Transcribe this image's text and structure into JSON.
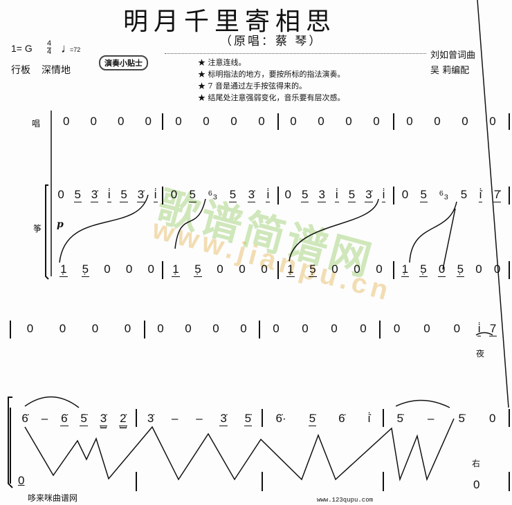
{
  "title": "明月千里寄相思",
  "subtitle": "（原唱：蔡  琴）",
  "key": "1= G",
  "time_top": "4",
  "time_bottom": "4",
  "tempo": "=72",
  "tempo_word": "行板",
  "expression": "深情地",
  "tips_label": "演奏小贴士",
  "tips": [
    "★ 注意连线。",
    "★ 标明指法的地方，要按所标的指法演奏。",
    "★ 7 音是通过左手按弦得来的。",
    "★ 结尾处注意强弱变化，音乐要有层次感。"
  ],
  "credits": [
    "刘如曾词曲",
    "吴  莉编配"
  ],
  "parts": {
    "voice": "唱",
    "zheng": "筝",
    "dynamic": "p"
  },
  "watermark": {
    "cn": "歌谱简谱网",
    "url": "www.jianpu.cn"
  },
  "system1": {
    "voice": [
      [
        "0",
        "0",
        "0",
        "0"
      ],
      [
        "0",
        "0",
        "0",
        "0"
      ],
      [
        "0",
        "0",
        "0",
        "0"
      ],
      [
        "0",
        "0",
        "0",
        "0"
      ]
    ],
    "upper": [
      [
        {
          "n": "0"
        },
        {
          "n": "5",
          "u": 1
        },
        {
          "n": "3̇",
          "u": 1
        },
        {
          "n": "i̇",
          "u": 1
        },
        {
          "n": "5",
          "u": 1
        },
        {
          "n": "3̇",
          "u": 1
        },
        {
          "n": "i̇",
          "u": 1
        }
      ],
      [
        {
          "n": "0"
        },
        {
          "n": "5",
          "u": 1
        },
        {
          "n": "⁶₃"
        },
        {
          "n": "5",
          "u": 1
        },
        {
          "n": "3̇",
          "u": 1
        },
        {
          "n": "i̇",
          "u": 1
        }
      ],
      [
        {
          "n": "0"
        },
        {
          "n": "5",
          "u": 1
        },
        {
          "n": "3",
          "u": 1
        },
        {
          "n": "i̇",
          "u": 1
        },
        {
          "n": "5",
          "u": 1
        },
        {
          "n": "3̇",
          "u": 1
        },
        {
          "n": "i̇",
          "u": 1
        }
      ],
      [
        {
          "n": "0"
        },
        {
          "n": "5",
          "u": 1
        },
        {
          "n": "⁶₃"
        },
        {
          "n": "5"
        },
        {
          "n": "i̇̇",
          "u": 1
        },
        {
          "n": "7̇",
          "u": 1
        }
      ]
    ],
    "lower": [
      [
        {
          "n": "1̣",
          "u": 1
        },
        {
          "n": "5̣",
          "u": 1
        },
        {
          "n": "0"
        },
        {
          "n": "0"
        },
        {
          "n": "0"
        }
      ],
      [
        {
          "n": "1̣",
          "u": 1
        },
        {
          "n": "5̣",
          "u": 1
        },
        {
          "n": "0"
        },
        {
          "n": "0"
        },
        {
          "n": "0"
        }
      ],
      [
        {
          "n": "1̣",
          "u": 1
        },
        {
          "n": "5̣",
          "u": 1
        },
        {
          "n": "0"
        },
        {
          "n": "0"
        },
        {
          "n": "0"
        }
      ],
      [
        {
          "n": "1̣",
          "u": 1
        },
        {
          "n": "5̣",
          "u": 1
        },
        {
          "n": "0",
          "u": 1
        },
        {
          "n": "5̣",
          "u": 1
        },
        {
          "n": "0"
        },
        {
          "n": "0"
        }
      ]
    ]
  },
  "system2": {
    "voice": [
      [
        "0",
        "0",
        "0",
        "0"
      ],
      [
        "0",
        "0",
        "0",
        "0"
      ],
      [
        "0",
        "0",
        "0",
        "0"
      ],
      [
        "0",
        "0",
        "0"
      ]
    ],
    "voice_pickup": [
      {
        "n": "i̇",
        "u": 1
      },
      {
        "n": "7",
        "u": 1
      }
    ],
    "lyric": "夜",
    "upper": [
      [
        {
          "n": "6̇"
        },
        {
          "n": "–"
        },
        {
          "n": "6̇",
          "u": 1
        },
        {
          "n": "5̇",
          "u": 1
        },
        {
          "n": "3̇",
          "u": 2
        },
        {
          "n": "2̇",
          "u": 2
        }
      ],
      [
        {
          "n": "3̇"
        },
        {
          "n": "–"
        },
        {
          "n": "–"
        },
        {
          "n": "3̇",
          "u": 1
        },
        {
          "n": "5̇",
          "u": 1
        }
      ],
      [
        {
          "n": "6̇·"
        },
        {
          "n": "5̇",
          "u": 1
        },
        {
          "n": "6̇"
        },
        {
          "n": "i̇̇"
        }
      ],
      [
        {
          "n": "5̇"
        },
        {
          "n": "–"
        },
        {
          "n": "5̇"
        },
        {
          "n": "0"
        }
      ]
    ],
    "lower_first": "0",
    "lower_last": "0",
    "hand": "右"
  },
  "footer": {
    "site_name": "哆来咪曲谱网",
    "site_url": "www.123qupu.com"
  }
}
